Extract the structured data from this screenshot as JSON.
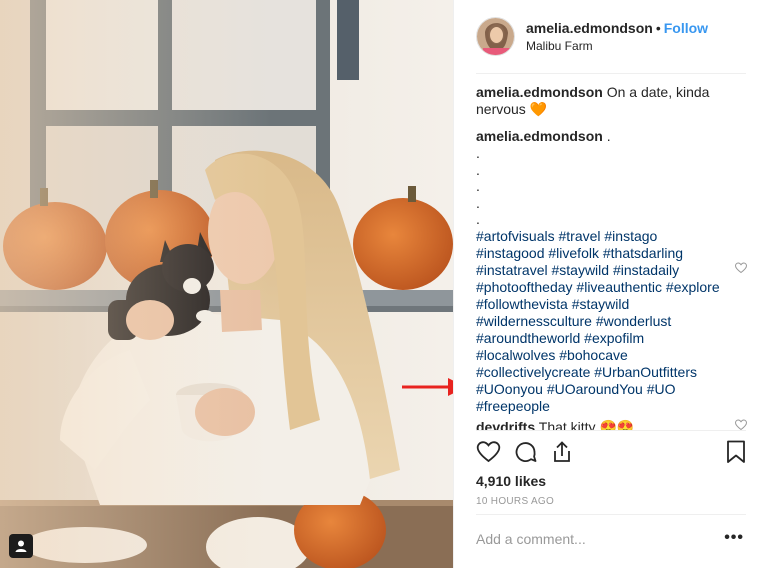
{
  "post": {
    "username": "amelia.edmondson",
    "separator": "•",
    "follow_label": "Follow",
    "location": "Malibu Farm"
  },
  "caption": {
    "username": "amelia.edmondson",
    "text": "On a date, kinda nervous",
    "emoji": "🧡"
  },
  "comment2": {
    "username": "amelia.edmondson",
    "first_dot": ".",
    "dots": [
      ".",
      ".",
      ".",
      ".",
      "."
    ],
    "hashtag_lines": [
      "#artofvisuals #travel #instago",
      "#instagood #livefolk #thatsdarling",
      "#instatravel #staywild #instadaily",
      "#photooftheday #liveauthentic #explore",
      "#followthevista #staywild",
      "#wildernessculture #wonderlust",
      "#aroundtheworld #expofilm",
      "#localwolves #bohocave",
      "#collectivelycreate #UrbanOutfitters",
      "#UOonyou #UOaroundYou #UO",
      "#freepeople"
    ]
  },
  "reply": {
    "username": "devdrifts",
    "text": "That kitty",
    "emoji": "😍😍"
  },
  "likes_text": "4,910 likes",
  "time_text": "10 HOURS AGO",
  "comment_placeholder": "Add a comment...",
  "more_label": "•••",
  "colors": {
    "follow": "#3897f0",
    "hashtag": "#003569",
    "annotation_arrow": "#e8231f"
  }
}
